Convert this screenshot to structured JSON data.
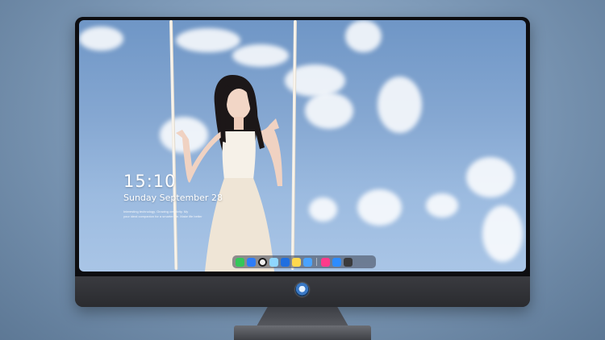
{
  "lock_screen": {
    "time": "15:10",
    "date": "Sunday September 28",
    "tagline_line1": "Interesting technology. Growing creativity. My",
    "tagline_line2": "your ideal companion for a smarter life. Make life better"
  },
  "dock": {
    "items": [
      {
        "name": "messages-icon",
        "color": "#34c759"
      },
      {
        "name": "finder-icon",
        "color": "#2f7df6"
      },
      {
        "name": "safari-icon",
        "color": "#f0f0f0"
      },
      {
        "name": "photos-icon",
        "color": "#8fd6ff"
      },
      {
        "name": "clapper-icon",
        "color": "#1f6fe0"
      },
      {
        "name": "notes-icon",
        "color": "#ffd84d"
      },
      {
        "name": "app-store-icon",
        "color": "#4aa3ff"
      },
      {
        "name": "music-icon",
        "color": "#ff3b8b"
      },
      {
        "name": "appstore-a-icon",
        "color": "#2d8cff"
      },
      {
        "name": "terminal-icon",
        "color": "#3a3a3c"
      }
    ]
  },
  "colors": {
    "background": "#7f9bb9",
    "screen_sky": "#86a8d2",
    "bezel": "#0d0d10",
    "chin": "#2b2c30"
  }
}
